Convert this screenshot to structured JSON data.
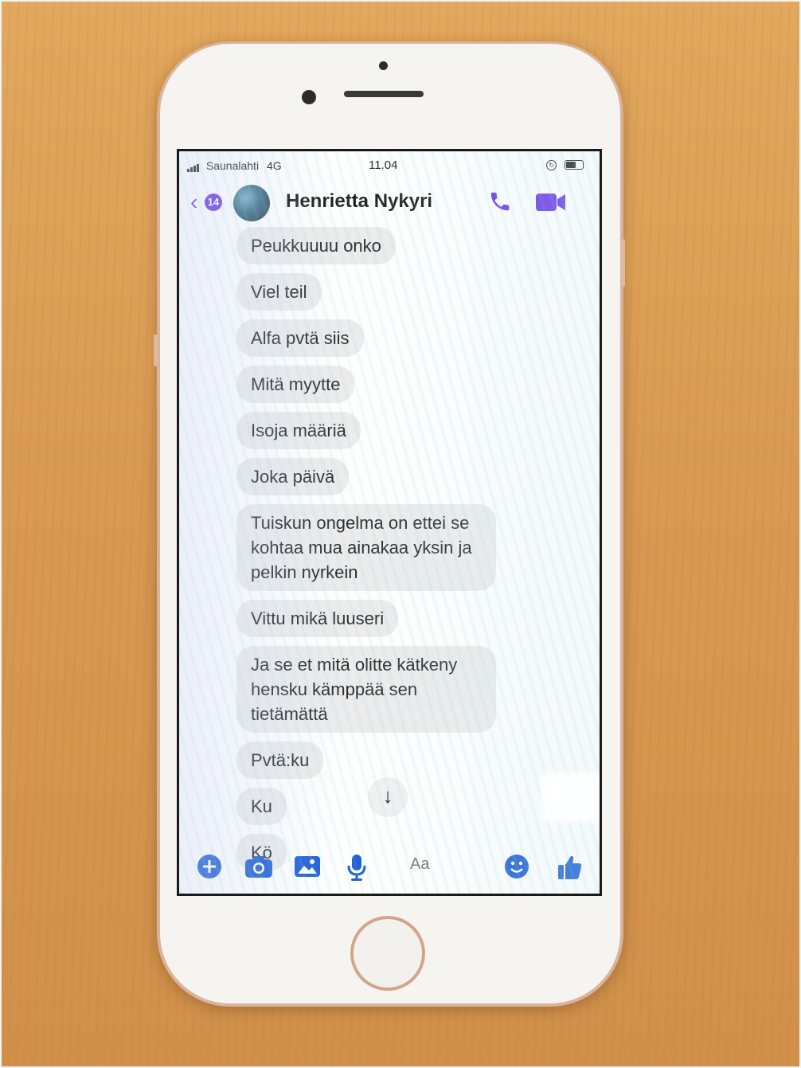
{
  "status_bar": {
    "carrier": "Saunalahti",
    "network": "4G",
    "time": "11.04"
  },
  "header": {
    "back_count": "14",
    "contact_name": "Henrietta Nykyri",
    "icons": [
      "back-chevron-icon",
      "phone-icon",
      "video-camera-icon"
    ]
  },
  "messages": [
    "Peukkuuuu onko",
    "Viel teil",
    "Alfa pvtä siis",
    "Mitä myytte",
    "Isoja määriä",
    "Joka päivä",
    "Tuiskun ongelma on ettei se kohtaa mua ainakaa yksin ja pelkin nyrkein",
    "Vittu mikä luuseri",
    "Ja se et mitä olitte kätkeny hensku kämppää sen tietämättä",
    "Pvtä:ku",
    "Ku",
    "Kö"
  ],
  "scroll_down_glyph": "↓",
  "composer": {
    "placeholder": "Aa",
    "icons": [
      "plus-icon",
      "camera-icon",
      "image-icon",
      "microphone-icon",
      "emoji-icon",
      "thumbs-up-icon"
    ]
  },
  "colors": {
    "accent": "#6a38e6",
    "composer_icon": "#1f5fd6",
    "bubble": "#ececec",
    "table": "#d89a52"
  }
}
